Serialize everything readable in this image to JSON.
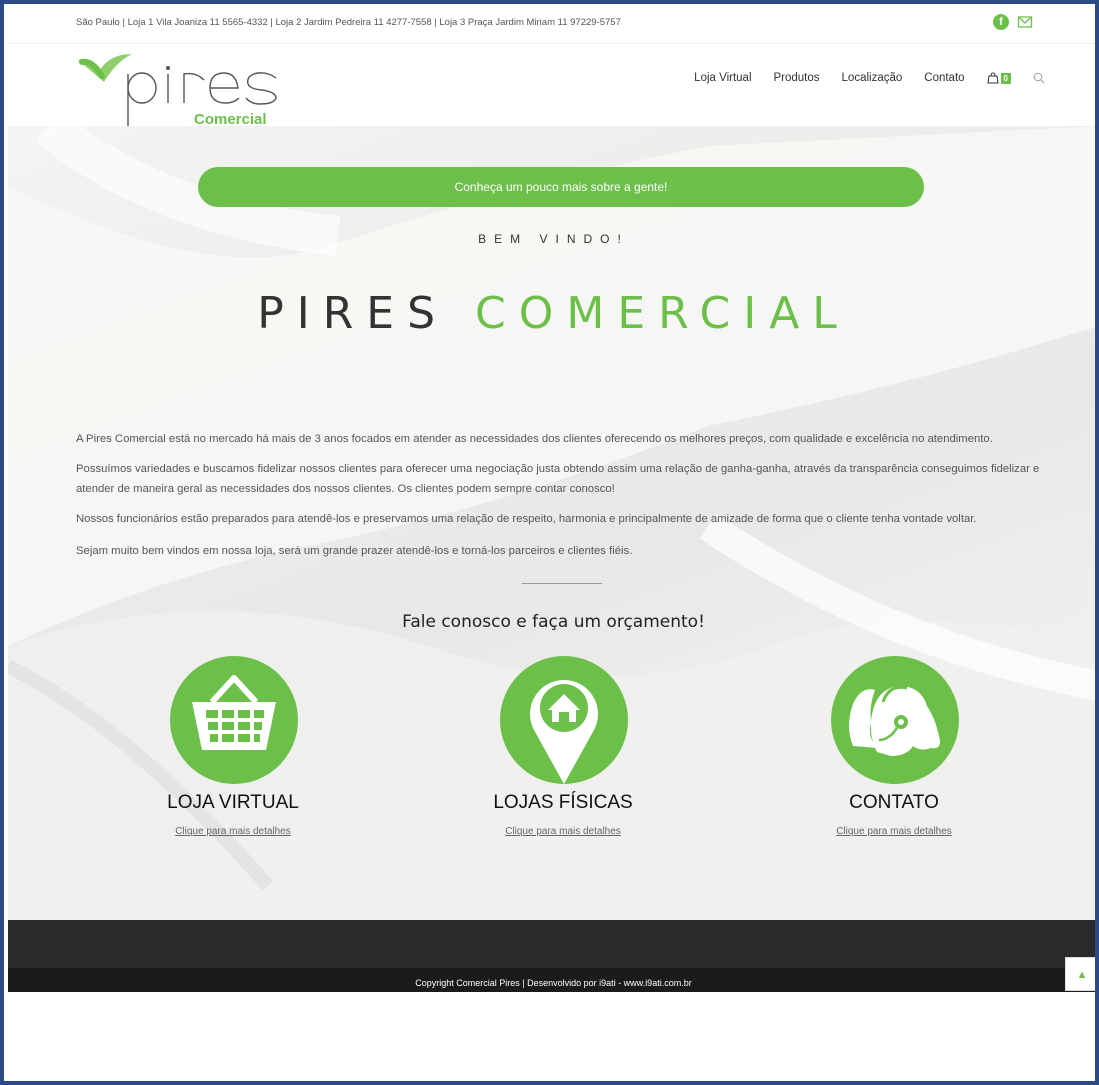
{
  "topbar": {
    "address": "São Paulo | Loja 1 Vila Joaniza 11 5565-4332 | Loja 2 Jardim Pedreira 11 4277-7558 | Loja 3 Praça Jardim Miriam 11 97229-5757",
    "icons": [
      "facebook-icon",
      "mail-icon"
    ]
  },
  "logo": {
    "word": "pires",
    "sub": "Comercial"
  },
  "nav": {
    "items": [
      "Loja Virtual",
      "Produtos",
      "Localização",
      "Contato"
    ],
    "cart_count": "0"
  },
  "hero": {
    "cta": "Conheça um pouco mais sobre a gente!",
    "welcome": "BEM VINDO!",
    "title_part1": "PIRES",
    "title_part2": "COMERCIAL",
    "paragraphs": [
      "A Pires Comercial está no mercado há mais de 3 anos focados em atender as necessidades dos clientes oferecendo os melhores preços, com qualidade e excelência no atendimento.",
      "Possuímos variedades e buscamos fidelizar nossos clientes para oferecer uma negociação justa obtendo assim uma relação de ganha-ganha, através da transparência conseguimos fidelizar e atender de maneira geral as necessidades dos nossos clientes. Os clientes podem sempre contar conosco!",
      "Nossos funcionários estão preparados para atendê-los e preservamos uma relação de respeito, harmonia e principalmente de amizade de forma que o cliente tenha vontade voltar.",
      "Sejam muito bem vindos em nossa loja, será um grande prazer atendê-los e torná-los parceiros e clientes fiéis."
    ],
    "contact_heading": "Fale conosco e faça um orçamento!"
  },
  "cards": [
    {
      "title": "LOJA VIRTUAL",
      "link": "Clique para mais detalhes",
      "icon": "basket-icon"
    },
    {
      "title": "LOJAS FÍSICAS",
      "link": "Clique para mais detalhes",
      "icon": "location-house-icon"
    },
    {
      "title": "CONTATO",
      "link": "Clique para mais detalhes",
      "icon": "headset-people-icon"
    }
  ],
  "footer": {
    "copyright": "Copyright Comercial Pires | Desenvolvido por i9ati - www.i9ati.com.br"
  },
  "colors": {
    "brand_green": "#6cc04a",
    "footer_dark": "#2a2a2a"
  }
}
